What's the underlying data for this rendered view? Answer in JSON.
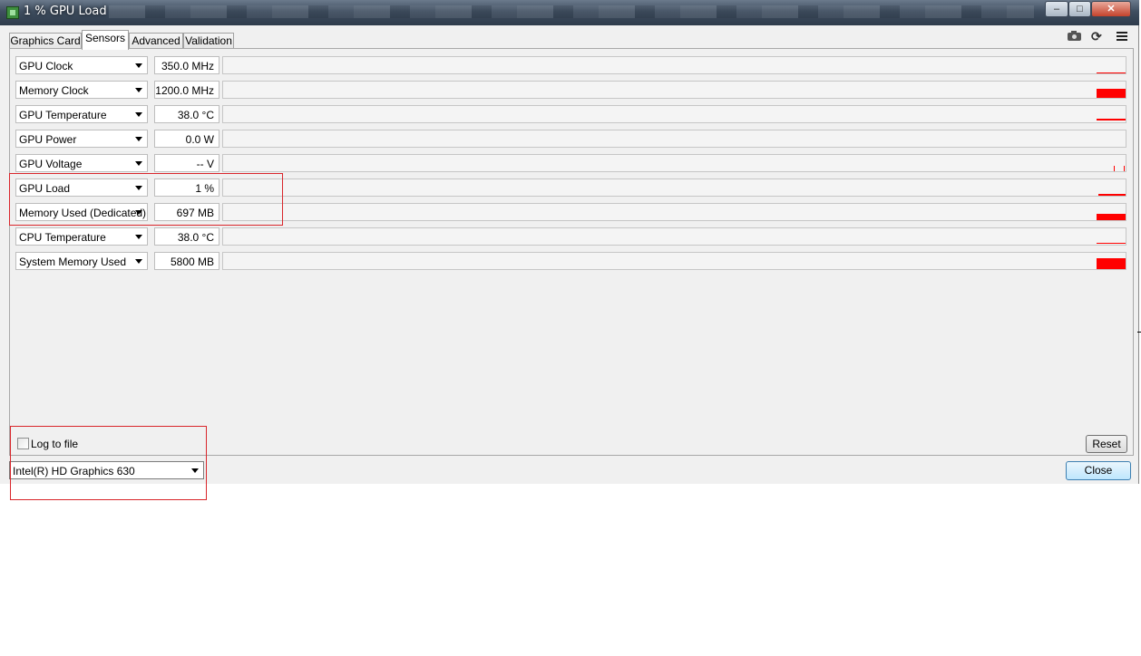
{
  "window": {
    "title": "1 % GPU Load",
    "min_glyph": "–",
    "max_glyph": "□",
    "close_glyph": "✕"
  },
  "tabs": [
    {
      "label": "Graphics Card",
      "active": false
    },
    {
      "label": "Sensors",
      "active": true
    },
    {
      "label": "Advanced",
      "active": false
    },
    {
      "label": "Validation",
      "active": false
    }
  ],
  "toolbar": {
    "icons": [
      "camera-icon",
      "refresh-icon",
      "menu-icon"
    ],
    "refresh_glyph": "⟳"
  },
  "sensors": [
    {
      "name": "GPU Clock",
      "value": "350.0 MHz"
    },
    {
      "name": "Memory Clock",
      "value": "1200.0 MHz"
    },
    {
      "name": "GPU Temperature",
      "value": "38.0 °C"
    },
    {
      "name": "GPU Power",
      "value": "0.0 W"
    },
    {
      "name": "GPU Voltage",
      "value": "-- V"
    },
    {
      "name": "GPU Load",
      "value": "1 %"
    },
    {
      "name": "Memory Used (Dedicated)",
      "value": "697 MB"
    },
    {
      "name": "CPU Temperature",
      "value": "38.0 °C"
    },
    {
      "name": "System Memory Used",
      "value": "5800 MB"
    }
  ],
  "bottom": {
    "log_label": "Log to file",
    "log_checked": false,
    "reset_label": "Reset",
    "device": "Intel(R) HD Graphics 630",
    "close_label": "Close"
  },
  "colors": {
    "graph_bar": "#ff0000",
    "annotation_box": "#d9262b"
  }
}
